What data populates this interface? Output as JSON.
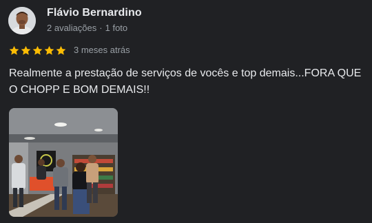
{
  "review": {
    "author_name": "Flávio Bernardino",
    "review_count": "2 avaliações",
    "separator": "·",
    "photo_count": "1 foto",
    "rating": 5,
    "max_rating": 5,
    "relative_date": "3 meses atrás",
    "text": "Realmente a prestação de serviços de vocês e top demais...FORA QUE O CHOPP E BOM DEMAIS!!"
  },
  "colors": {
    "background": "#202124",
    "star": "#fbbc04",
    "primary_text": "#e8eaed",
    "secondary_text": "#9aa0a6"
  },
  "icons": {
    "star": "star-icon"
  }
}
